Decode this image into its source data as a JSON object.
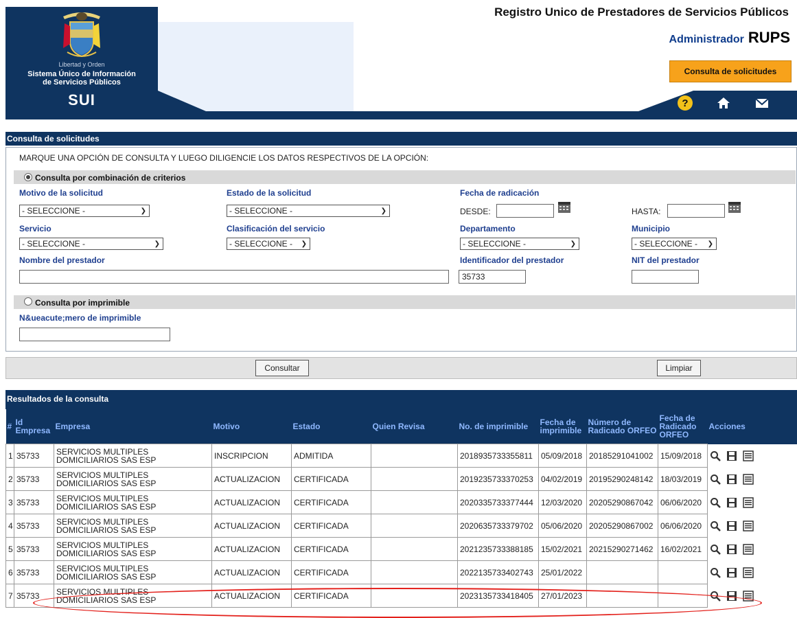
{
  "header": {
    "top_title": "Registro Unico de Prestadores de Servicios Públicos",
    "admin_label": "Administrador",
    "rups_label": "RUPS",
    "consulta_button": "Consulta de solicitudes",
    "logo_motto": "Libertad y Orden",
    "logo_system_line1": "Sistema Único de Información",
    "logo_system_line2": "de Servicios Públicos",
    "logo_acronym": "SUI",
    "icons": [
      "help-icon",
      "home-icon",
      "mail-icon"
    ]
  },
  "colors": {
    "navy": "#0f3460",
    "orange": "#f7a21b",
    "label_blue": "#1f3f8f",
    "highlight_red": "#e3201b"
  },
  "consulta": {
    "section_title": "Consulta de solicitudes",
    "instruction": "MARQUE UNA OPCIÓN DE CONSULTA Y LUEGO DILIGENCIE LOS DATOS RESPECTIVOS DE LA OPCIÓN:",
    "option1": {
      "label": "Consulta por combinación de criterios",
      "selected": true,
      "motivo_label": "Motivo de la solicitud",
      "motivo_value": "- SELECCIONE -",
      "estado_label": "Estado de la solicitud",
      "estado_value": "- SELECCIONE -",
      "fecha_label": "Fecha de radicación",
      "desde_label": "DESDE:",
      "hasta_label": "HASTA:",
      "servicio_label": "Servicio",
      "servicio_value": "- SELECCIONE -",
      "clasificacion_label": "Clasificación del servicio",
      "clasificacion_value": "- SELECCIONE -",
      "departamento_label": "Departamento",
      "departamento_value": "- SELECCIONE -",
      "municipio_label": "Municipio",
      "municipio_value": "- SELECCIONE -",
      "nombre_label": "Nombre del prestador",
      "nombre_value": "",
      "identificador_label": "Identificador del prestador",
      "identificador_value": "35733",
      "nit_label": "NIT del prestador",
      "nit_value": ""
    },
    "option2": {
      "label": "Consulta por imprimible",
      "selected": false,
      "numero_label": "N&ueacute;mero de imprimible",
      "numero_value": ""
    },
    "consultar_button": "Consultar",
    "limpiar_button": "Limpiar"
  },
  "results": {
    "section_title": "Resultados de la consulta",
    "columns": [
      "#",
      "Id Empresa",
      "Empresa",
      "Motivo",
      "Estado",
      "Quien Revisa",
      "No. de imprimible",
      "Fecha de imprimible",
      "Número de Radicado ORFEO",
      "Fecha de Radicado ORFEO",
      "Acciones"
    ],
    "action_icons": [
      "view-icon",
      "save-icon",
      "detail-icon"
    ],
    "rows": [
      {
        "n": "1",
        "id": "35733",
        "empresa": "SERVICIOS MULTIPLES DOMICILIARIOS SAS ESP",
        "motivo": "INSCRIPCION",
        "estado": "ADMITIDA",
        "revisa": "",
        "imprimible": "2018935733355811",
        "fecha_imp": "05/09/2018",
        "radicado": "20185291041002",
        "fecha_rad": "15/09/2018"
      },
      {
        "n": "2",
        "id": "35733",
        "empresa": "SERVICIOS MULTIPLES DOMICILIARIOS SAS ESP",
        "motivo": "ACTUALIZACION",
        "estado": "CERTIFICADA",
        "revisa": "",
        "imprimible": "2019235733370253",
        "fecha_imp": "04/02/2019",
        "radicado": "20195290248142",
        "fecha_rad": "18/03/2019"
      },
      {
        "n": "3",
        "id": "35733",
        "empresa": "SERVICIOS MULTIPLES DOMICILIARIOS SAS ESP",
        "motivo": "ACTUALIZACION",
        "estado": "CERTIFICADA",
        "revisa": "",
        "imprimible": "2020335733377444",
        "fecha_imp": "12/03/2020",
        "radicado": "20205290867042",
        "fecha_rad": "06/06/2020"
      },
      {
        "n": "4",
        "id": "35733",
        "empresa": "SERVICIOS MULTIPLES DOMICILIARIOS SAS ESP",
        "motivo": "ACTUALIZACION",
        "estado": "CERTIFICADA",
        "revisa": "",
        "imprimible": "2020635733379702",
        "fecha_imp": "05/06/2020",
        "radicado": "20205290867002",
        "fecha_rad": "06/06/2020"
      },
      {
        "n": "5",
        "id": "35733",
        "empresa": "SERVICIOS MULTIPLES DOMICILIARIOS SAS ESP",
        "motivo": "ACTUALIZACION",
        "estado": "CERTIFICADA",
        "revisa": "",
        "imprimible": "2021235733388185",
        "fecha_imp": "15/02/2021",
        "radicado": "20215290271462",
        "fecha_rad": "16/02/2021"
      },
      {
        "n": "6",
        "id": "35733",
        "empresa": "SERVICIOS MULTIPLES DOMICILIARIOS SAS ESP",
        "motivo": "ACTUALIZACION",
        "estado": "CERTIFICADA",
        "revisa": "",
        "imprimible": "2022135733402743",
        "fecha_imp": "25/01/2022",
        "radicado": "",
        "fecha_rad": ""
      },
      {
        "n": "7",
        "id": "35733",
        "empresa": "SERVICIOS MULTIPLES DOMICILIARIOS SAS ESP",
        "motivo": "ACTUALIZACION",
        "estado": "CERTIFICADA",
        "revisa": "",
        "imprimible": "2023135733418405",
        "fecha_imp": "27/01/2023",
        "radicado": "",
        "fecha_rad": ""
      }
    ]
  }
}
